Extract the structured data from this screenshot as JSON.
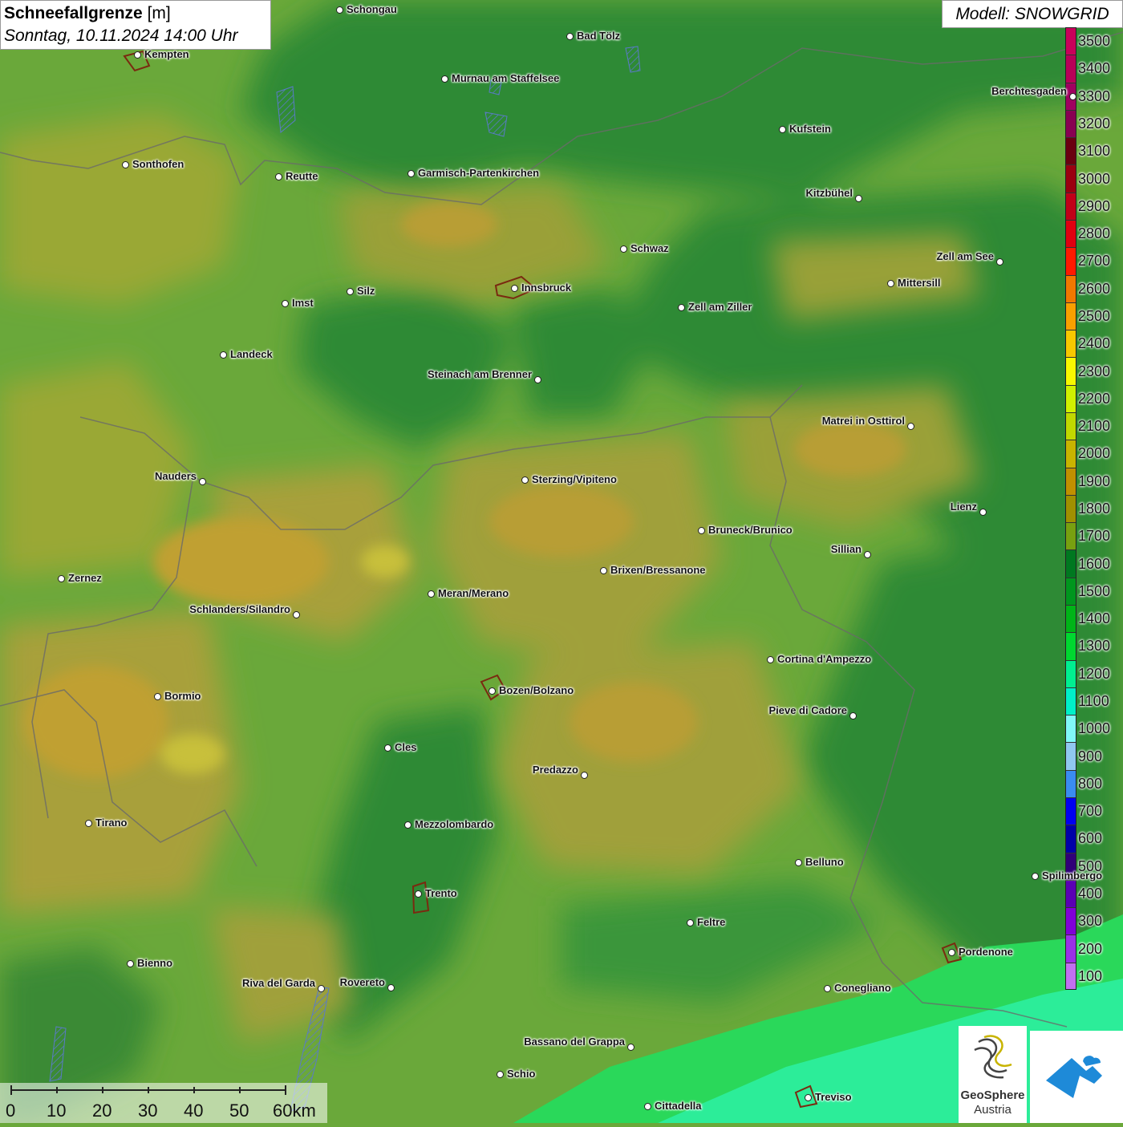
{
  "title": {
    "parameter": "Schneefallgrenze",
    "unit": "[m]",
    "datetime": "Sonntag, 10.11.2024 14:00 Uhr"
  },
  "model": "Modell: SNOWGRID",
  "legend": {
    "entries": [
      {
        "value": "3500",
        "color": "#c8005a"
      },
      {
        "value": "3400",
        "color": "#b80058"
      },
      {
        "value": "3300",
        "color": "#a00060"
      },
      {
        "value": "3200",
        "color": "#880052"
      },
      {
        "value": "3100",
        "color": "#6a0010"
      },
      {
        "value": "3000",
        "color": "#9a0010"
      },
      {
        "value": "2900",
        "color": "#c00018"
      },
      {
        "value": "2800",
        "color": "#e00010"
      },
      {
        "value": "2700",
        "color": "#ff1a00"
      },
      {
        "value": "2600",
        "color": "#f07800"
      },
      {
        "value": "2500",
        "color": "#f8a000"
      },
      {
        "value": "2400",
        "color": "#f8c800"
      },
      {
        "value": "2300",
        "color": "#f8f800"
      },
      {
        "value": "2200",
        "color": "#d0f000"
      },
      {
        "value": "2100",
        "color": "#c0d800"
      },
      {
        "value": "2000",
        "color": "#c8b400"
      },
      {
        "value": "1900",
        "color": "#c09000"
      },
      {
        "value": "1800",
        "color": "#a09000"
      },
      {
        "value": "1700",
        "color": "#78a010"
      },
      {
        "value": "1600",
        "color": "#007820"
      },
      {
        "value": "1500",
        "color": "#00961e"
      },
      {
        "value": "1400",
        "color": "#00b418"
      },
      {
        "value": "1300",
        "color": "#00d830"
      },
      {
        "value": "1200",
        "color": "#00f090"
      },
      {
        "value": "1100",
        "color": "#00f0c8"
      },
      {
        "value": "1000",
        "color": "#80f8f8"
      },
      {
        "value": "900",
        "color": "#90c8f0"
      },
      {
        "value": "800",
        "color": "#3a8cf0"
      },
      {
        "value": "700",
        "color": "#0000f0"
      },
      {
        "value": "600",
        "color": "#0000a8"
      },
      {
        "value": "500",
        "color": "#300078"
      },
      {
        "value": "400",
        "color": "#5a00b4"
      },
      {
        "value": "300",
        "color": "#8000d8"
      },
      {
        "value": "200",
        "color": "#9a30e8"
      },
      {
        "value": "100",
        "color": "#c070f0"
      }
    ]
  },
  "cities": [
    {
      "name": "Schongau"
    },
    {
      "name": "Bad Tölz"
    },
    {
      "name": "Kempten"
    },
    {
      "name": "Murnau am Staffelsee"
    },
    {
      "name": "Berchtesgaden"
    },
    {
      "name": "Kufstein"
    },
    {
      "name": "Sonthofen"
    },
    {
      "name": "Reutte"
    },
    {
      "name": "Garmisch-Partenkirchen"
    },
    {
      "name": "Kitzbühel"
    },
    {
      "name": "Schwaz"
    },
    {
      "name": "Zell am See"
    },
    {
      "name": "Innsbruck"
    },
    {
      "name": "Mittersill"
    },
    {
      "name": "Imst"
    },
    {
      "name": "Silz"
    },
    {
      "name": "Zell am Ziller"
    },
    {
      "name": "Landeck"
    },
    {
      "name": "Steinach am Brenner"
    },
    {
      "name": "Matrei in Osttirol"
    },
    {
      "name": "Nauders"
    },
    {
      "name": "Sterzing/Vipiteno"
    },
    {
      "name": "Lienz"
    },
    {
      "name": "Bruneck/Brunico"
    },
    {
      "name": "Sillian"
    },
    {
      "name": "Zernez"
    },
    {
      "name": "Brixen/Bressanone"
    },
    {
      "name": "Meran/Merano"
    },
    {
      "name": "Schlanders/Silandro"
    },
    {
      "name": "Cortina d'Ampezzo"
    },
    {
      "name": "Bozen/Bolzano"
    },
    {
      "name": "Bormio"
    },
    {
      "name": "Pieve di Cadore"
    },
    {
      "name": "Cles"
    },
    {
      "name": "Predazzo"
    },
    {
      "name": "Tirano"
    },
    {
      "name": "Mezzolombardo"
    },
    {
      "name": "Belluno"
    },
    {
      "name": "Trento"
    },
    {
      "name": "Feltre"
    },
    {
      "name": "Pordenone"
    },
    {
      "name": "Bienno"
    },
    {
      "name": "Riva del Garda"
    },
    {
      "name": "Rovereto"
    },
    {
      "name": "Conegliano"
    },
    {
      "name": "Bassano del Grappa"
    },
    {
      "name": "Schio"
    },
    {
      "name": "Treviso"
    },
    {
      "name": "Cittadella"
    },
    {
      "name": "Spilimbergo"
    }
  ],
  "scale": {
    "ticks": [
      "0",
      "10",
      "20",
      "30",
      "40",
      "50",
      "60km"
    ]
  },
  "logos": {
    "geosphere_line1": "GeoSphere",
    "geosphere_line2": "Austria"
  }
}
